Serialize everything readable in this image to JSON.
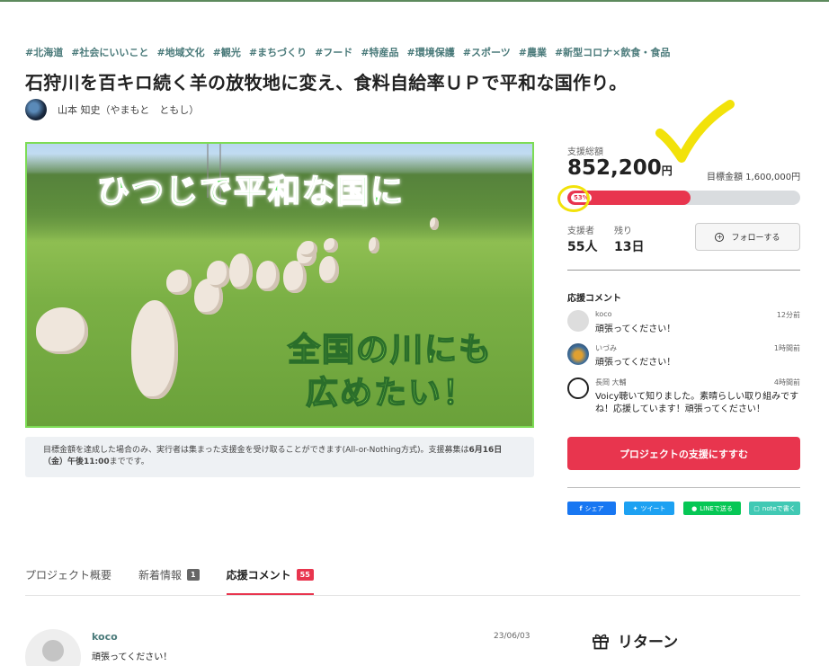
{
  "tags": [
    "#北海道",
    "#社会にいいこと",
    "#地域文化",
    "#観光",
    "#まちづくり",
    "#フード",
    "#特産品",
    "#環境保護",
    "#スポーツ",
    "#農業",
    "#新型コロナ×飲食・食品"
  ],
  "project": {
    "title": "石狩川を百キロ続く羊の放牧地に変え、食料自給率ＵＰで平和な国作り。",
    "author": "山本 知史（やまもと　ともし）"
  },
  "hero": {
    "text_line1": "ひつじで平和な国に",
    "text_line2": "全国の川にも",
    "text_line3": "広めたい！"
  },
  "notice": {
    "text": "目標金額を達成した場合のみ、実行者は集まった支援金を受け取ることができます(All-or-Nothing方式)。支援募集は",
    "deadline": "6月16日（金）午後11:00",
    "suffix": "までです。"
  },
  "funding": {
    "total_label": "支援総額",
    "amount": "852,200",
    "currency": "円",
    "goal_text": "目標金額 1,600,000円",
    "percent_label": "53%",
    "progress": 0.53,
    "backers_label": "支援者",
    "backers": "55人",
    "remaining_label": "残り",
    "remaining": "13日",
    "follow_label": "フォローする"
  },
  "comments_panel": {
    "title": "応援コメント",
    "items": [
      {
        "name": "koco",
        "time": "12分前",
        "body": "頑張ってください！"
      },
      {
        "name": "いづみ",
        "time": "1時間前",
        "body": "頑張ってください！"
      },
      {
        "name": "長岡 大輔",
        "time": "4時間前",
        "body": "Voicy聴いて知りました。素晴らしい取り組みですね！応援しています！頑張ってください！"
      }
    ]
  },
  "cta_label": "プロジェクトの支援にすすむ",
  "share": {
    "facebook": "シェア",
    "twitter": "ツイート",
    "line": "LINEで送る",
    "note": "noteで書く"
  },
  "tabs": [
    {
      "label": "プロジェクト概要"
    },
    {
      "label": "新着情報",
      "badge": "1"
    },
    {
      "label": "応援コメント",
      "badge": "55"
    }
  ],
  "latest_comment": {
    "name": "koco",
    "date": "23/06/03",
    "body": "頑張ってください！"
  },
  "returns_title": "リターン",
  "colors": {
    "accent": "#e8354e",
    "tag": "#4a7a7a",
    "highlight": "#f2e20a",
    "image_border": "#7ddc55"
  }
}
